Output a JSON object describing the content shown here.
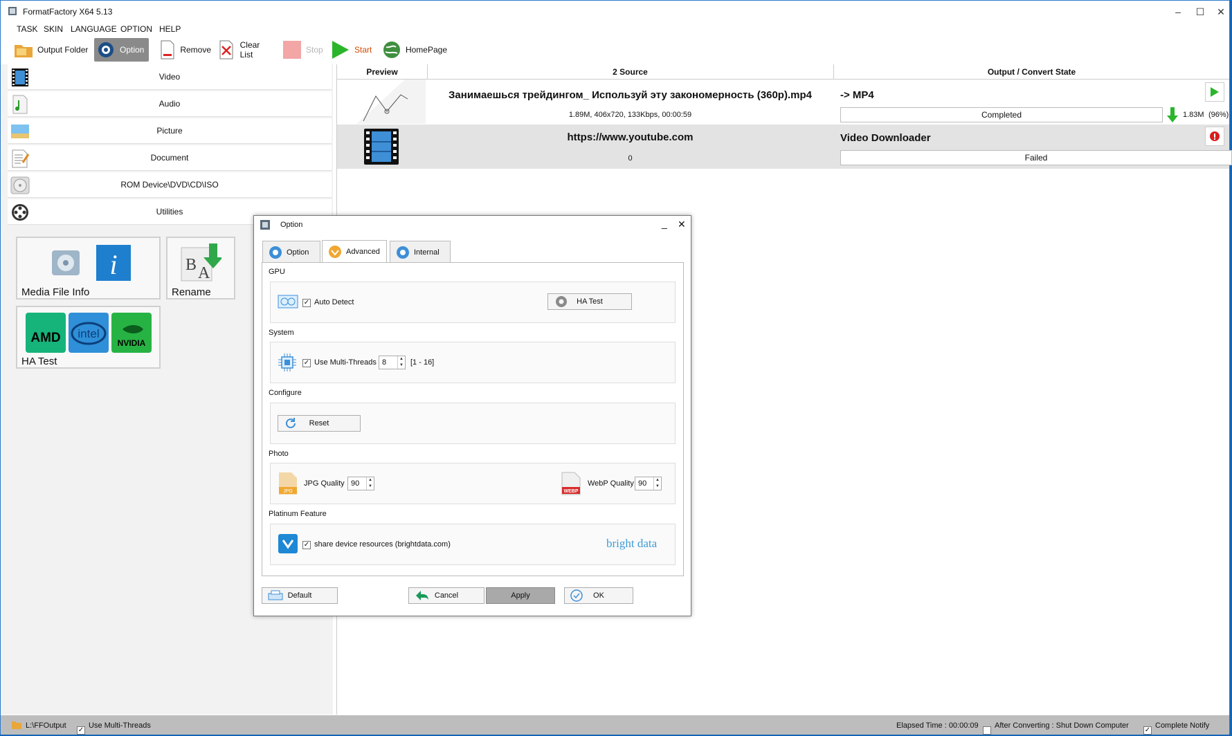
{
  "window": {
    "title": "FormatFactory X64 5.13"
  },
  "menu": [
    "TASK",
    "SKIN",
    "LANGUAGE",
    "OPTION",
    "HELP"
  ],
  "toolbar": {
    "output_folder": "Output Folder",
    "option": "Option",
    "remove": "Remove",
    "clear_list": "Clear List",
    "stop": "Stop",
    "start": "Start",
    "homepage": "HomePage"
  },
  "categories": [
    "Video",
    "Audio",
    "Picture",
    "Document",
    "ROM Device\\DVD\\CD\\ISO",
    "Utilities"
  ],
  "tools": {
    "media_info": "Media File Info",
    "rename": "Rename",
    "ha_test": "HA Test"
  },
  "grid": {
    "columns": [
      "Preview",
      "2 Source",
      "Output / Convert State"
    ],
    "rows": [
      {
        "title": "Занимаешься трейдингом_ Используй эту закономерность (360р).mp4",
        "info": "1.89M, 406x720, 133Kbps, 00:00:59",
        "output": "-> MP4",
        "state": "Completed",
        "size": "1.83M",
        "percent": "(96%)"
      },
      {
        "title": "https://www.youtube.com",
        "info": "0",
        "output": "Video Downloader",
        "state": "Failed"
      }
    ]
  },
  "status": {
    "path": "L:\\FFOutput",
    "multi": "Use Multi-Threads",
    "elapsed": "Elapsed Time : 00:00:09",
    "shutdown": "After Converting : Shut Down Computer",
    "notify": "Complete Notify"
  },
  "dialog": {
    "title": "Option",
    "tabs": [
      "Option",
      "Advanced",
      "Internal"
    ],
    "gpu": {
      "label": "GPU",
      "auto_detect": "Auto Detect",
      "ha_test": "HA Test"
    },
    "system": {
      "label": "System",
      "multi": "Use Multi-Threads",
      "threads": "8",
      "range": "[1 - 16]"
    },
    "configure": {
      "label": "Configure",
      "reset": "Reset"
    },
    "photo": {
      "label": "Photo",
      "jpg": "JPG Quality",
      "jpg_value": "90",
      "webp": "WebP Quality",
      "webp_value": "90",
      "jpg_badge": "JPG",
      "webp_badge": "WEBP"
    },
    "platinum": {
      "label": "Platinum Feature",
      "share": "share device resources (brightdata.com)",
      "brand": "bright data"
    },
    "buttons": {
      "default": "Default",
      "cancel": "Cancel",
      "apply": "Apply",
      "ok": "OK"
    }
  },
  "colors": {
    "accent_green": "#2bb52b",
    "brand_blue": "#3d9bd6",
    "selection_gray": "#8a8a8a"
  }
}
